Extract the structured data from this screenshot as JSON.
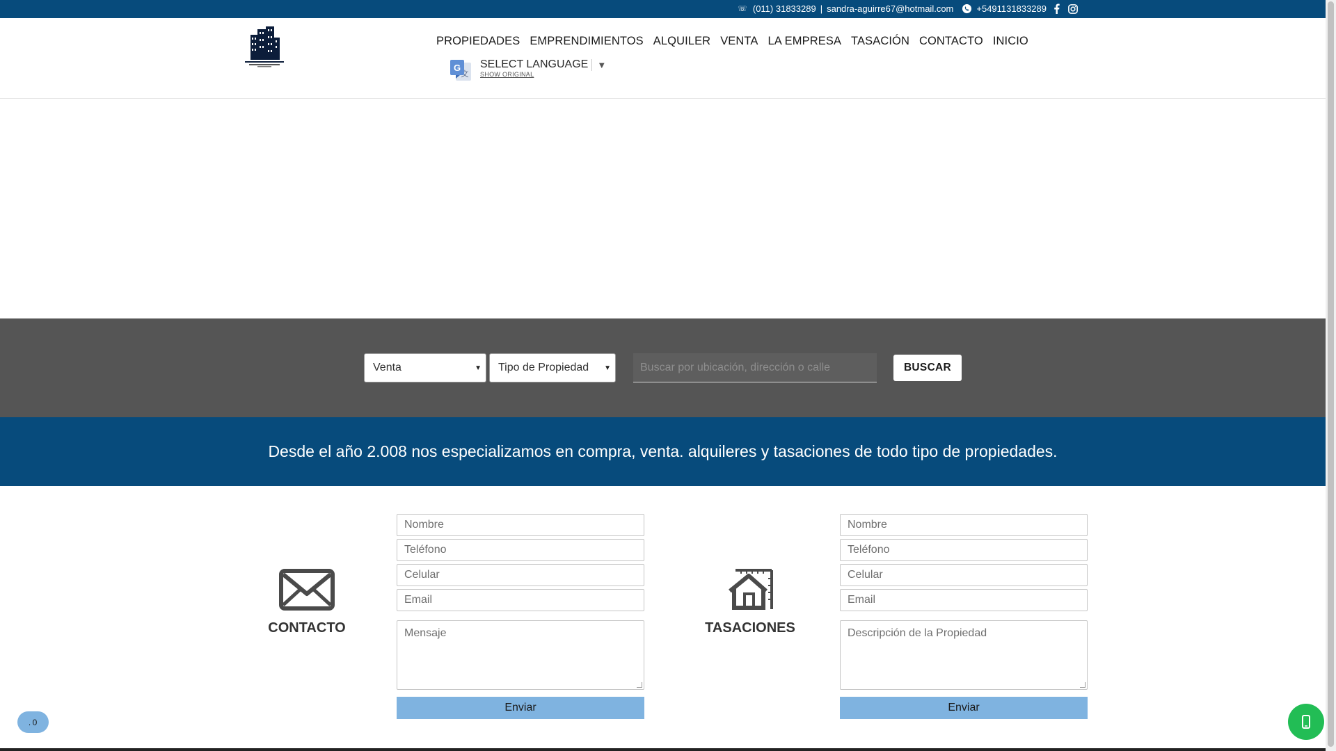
{
  "topbar": {
    "phone": "(011) 31833289",
    "separator": "|",
    "email": "sandra-aguirre67@hotmail.com",
    "whatsapp": "+5491131833289",
    "icons": [
      "phone-icon",
      "whatsapp-icon",
      "facebook-icon",
      "instagram-icon"
    ]
  },
  "nav": {
    "items": [
      {
        "label": "PROPIEDADES"
      },
      {
        "label": "EMPRENDIMIENTOS"
      },
      {
        "label": "ALQUILER"
      },
      {
        "label": "VENTA"
      },
      {
        "label": "LA EMPRESA"
      },
      {
        "label": "TASACIÓN"
      },
      {
        "label": "CONTACTO"
      },
      {
        "label": "INICIO"
      }
    ]
  },
  "translate": {
    "select_label": "SELECT LANGUAGE",
    "arrow": "▼",
    "show_original": "SHOW ORIGINAL"
  },
  "search": {
    "operation_value": "Venta",
    "type_value": "Tipo de Propiedad",
    "placeholder": "Buscar por ubicación, dirección o calle",
    "button": "BUSCAR"
  },
  "tagline": "Desde el año 2.008 nos especializamos en compra, venta. alquileres y tasaciones de todo tipo de propiedades.",
  "contacto": {
    "title": "CONTACTO",
    "fields": {
      "nombre": "Nombre",
      "telefono": "Teléfono",
      "celular": "Celular",
      "email": "Email",
      "mensaje": "Mensaje"
    },
    "submit": "Enviar"
  },
  "tasaciones": {
    "title": "TASACIONES",
    "fields": {
      "nombre": "Nombre",
      "telefono": "Teléfono",
      "celular": "Celular",
      "email": "Email",
      "descripcion": "Descripción de la Propiedad"
    },
    "submit": "Enviar"
  },
  "floating": {
    "counter": "0"
  },
  "colors": {
    "brand_blue": "#074b7c",
    "search_band": "#555555",
    "button_light_blue": "#7fb3e0",
    "whatsapp_green": "#22bd55"
  }
}
